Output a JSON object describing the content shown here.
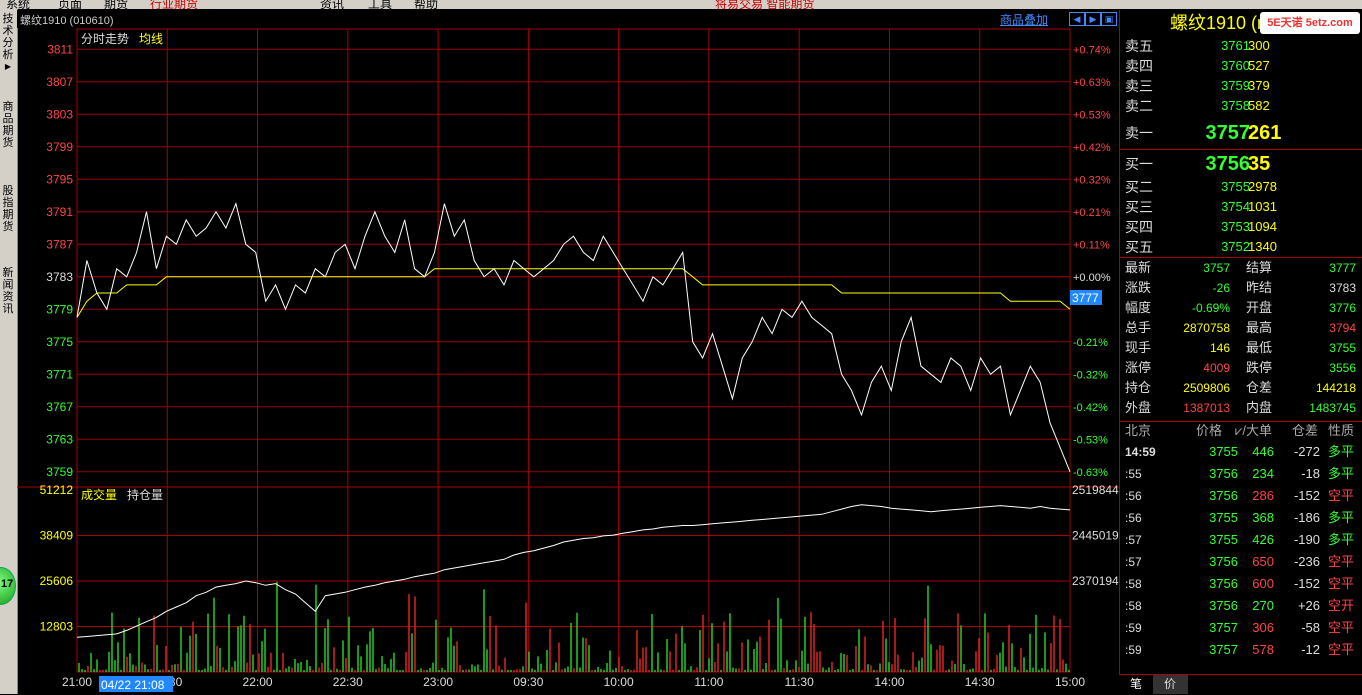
{
  "menu": [
    "系统",
    "页面",
    "期货",
    "行业期货",
    "",
    "资讯",
    "工具",
    "帮助"
  ],
  "menu_center": "将易交易 智能期货",
  "left_tabs": [
    "技术分析",
    "商品期货",
    "股指期货",
    "新闻资讯"
  ],
  "green_badge": "17",
  "chart_title": "螺纹1910 (010610)",
  "overlay_btn": "商品叠加",
  "price_legend": {
    "main": "分时走势",
    "avg": "均线"
  },
  "vol_legend": {
    "vol": "成交量",
    "oi": "持仓量"
  },
  "cursor_price": "3777",
  "cursor_time": "04/22 21:08",
  "chart_data": {
    "type": "line",
    "title": "螺纹1910 (010610)",
    "y_ticks": [
      "3811",
      "3807",
      "3803",
      "3799",
      "3795",
      "3791",
      "3787",
      "3783",
      "3779",
      "3775",
      "3771",
      "3767",
      "3763",
      "3759"
    ],
    "pct_ticks": [
      "+0.74%",
      "+0.63%",
      "+0.53%",
      "+0.42%",
      "+0.32%",
      "+0.21%",
      "+0.11%",
      "+0.00%",
      "-0.21%",
      "-0.32%",
      "-0.42%",
      "-0.53%",
      "-0.63%"
    ],
    "ylim": [
      3757.5,
      3813
    ],
    "prev_settle": 3783,
    "x_ticks": [
      "21:00",
      "21:30",
      "22:00",
      "22:30",
      "23:00",
      "09:30",
      "10:00",
      "11:00",
      "11:30",
      "14:00",
      "14:30",
      "15:00"
    ],
    "price": [
      3778,
      3785,
      3781,
      3779,
      3784,
      3783,
      3786,
      3791,
      3784,
      3788,
      3787,
      3790,
      3788,
      3789,
      3791,
      3789,
      3792,
      3787,
      3786,
      3780,
      3782,
      3779,
      3782,
      3781,
      3784,
      3783,
      3786,
      3787,
      3784,
      3788,
      3791,
      3788,
      3786,
      3790,
      3784,
      3783,
      3786,
      3792,
      3788,
      3790,
      3785,
      3783,
      3784,
      3782,
      3785,
      3784,
      3783,
      3784,
      3785,
      3787,
      3788,
      3786,
      3785,
      3788,
      3786,
      3784,
      3782,
      3780,
      3783,
      3782,
      3784,
      3786,
      3775,
      3773,
      3776,
      3772,
      3768,
      3773,
      3775,
      3778,
      3776,
      3779,
      3778,
      3780,
      3778,
      3777,
      3776,
      3771,
      3769,
      3766,
      3770,
      3772,
      3769,
      3775,
      3778,
      3772,
      3771,
      3770,
      3773,
      3772,
      3769,
      3773,
      3771,
      3772,
      3766,
      3769,
      3772,
      3770,
      3765,
      3762,
      3759
    ],
    "avg": [
      3778,
      3780,
      3781,
      3781,
      3781,
      3782,
      3782,
      3782,
      3782,
      3783,
      3783,
      3783,
      3783,
      3783,
      3783,
      3783,
      3783,
      3783,
      3783,
      3783,
      3783,
      3783,
      3783,
      3783,
      3783,
      3783,
      3783,
      3783,
      3783,
      3783,
      3783,
      3783,
      3783,
      3783,
      3783,
      3783,
      3784,
      3784,
      3784,
      3784,
      3784,
      3784,
      3784,
      3784,
      3784,
      3784,
      3784,
      3784,
      3784,
      3784,
      3784,
      3784,
      3784,
      3784,
      3784,
      3784,
      3784,
      3784,
      3784,
      3784,
      3784,
      3784,
      3783,
      3782,
      3782,
      3782,
      3782,
      3782,
      3782,
      3782,
      3782,
      3782,
      3782,
      3782,
      3782,
      3782,
      3782,
      3781,
      3781,
      3781,
      3781,
      3781,
      3781,
      3781,
      3781,
      3781,
      3781,
      3781,
      3781,
      3781,
      3781,
      3781,
      3781,
      3781,
      3780,
      3780,
      3780,
      3780,
      3780,
      3780,
      3779
    ],
    "vol_ticks": [
      "51212",
      "38409",
      "25606",
      "12803"
    ],
    "oi_ticks": [
      "2519844",
      "2445019",
      "2370194"
    ],
    "vol_max": 51212,
    "oi_range": [
      2330000,
      2540000
    ],
    "oi": [
      2370000,
      2371000,
      2372000,
      2373000,
      2374000,
      2378000,
      2383000,
      2388000,
      2393000,
      2400000,
      2405000,
      2410000,
      2418000,
      2422000,
      2428000,
      2430000,
      2432000,
      2435000,
      2433000,
      2430000,
      2432000,
      2425000,
      2420000,
      2410000,
      2400000,
      2418000,
      2420000,
      2422000,
      2425000,
      2428000,
      2430000,
      2433000,
      2435000,
      2437000,
      2440000,
      2442000,
      2444000,
      2448000,
      2450000,
      2452000,
      2454000,
      2456000,
      2458000,
      2460000,
      2465000,
      2468000,
      2470000,
      2473000,
      2476000,
      2480000,
      2482000,
      2484000,
      2485000,
      2487000,
      2488000,
      2490000,
      2492000,
      2494000,
      2495000,
      2497000,
      2498000,
      2499000,
      2499000,
      2500000,
      2501000,
      2502000,
      2503000,
      2504000,
      2505000,
      2506000,
      2507000,
      2508000,
      2509000,
      2510000,
      2511000,
      2512000,
      2515000,
      2518000,
      2521000,
      2523000,
      2522000,
      2521000,
      2519000,
      2518000,
      2517000,
      2516000,
      2515000,
      2516000,
      2517000,
      2518000,
      2519000,
      2520000,
      2521000,
      2522000,
      2521000,
      2520000,
      2519000,
      2521000,
      2519000,
      2518000,
      2517000
    ]
  },
  "order_book": {
    "asks": [
      {
        "label": "卖五",
        "price": "3761",
        "vol": "300"
      },
      {
        "label": "卖四",
        "price": "3760",
        "vol": "527"
      },
      {
        "label": "卖三",
        "price": "3759",
        "vol": "379"
      },
      {
        "label": "卖二",
        "price": "3758",
        "vol": "582"
      }
    ],
    "ask1": {
      "label": "卖一",
      "price": "3757",
      "vol": "261"
    },
    "bid1": {
      "label": "买一",
      "price": "3756",
      "vol": "35"
    },
    "bids": [
      {
        "label": "买二",
        "price": "3755",
        "vol": "2978"
      },
      {
        "label": "买三",
        "price": "3754",
        "vol": "1031"
      },
      {
        "label": "买四",
        "price": "3753",
        "vol": "1094"
      },
      {
        "label": "买五",
        "price": "3752",
        "vol": "1340"
      }
    ]
  },
  "right_title": "螺纹1910 (r",
  "brand": "5E天诺 5etz.com",
  "stats": [
    {
      "l1": "最新",
      "v1": "3757",
      "c1": "#3f3",
      "l2": "结算",
      "v2": "3777",
      "c2": "#3f3"
    },
    {
      "l1": "涨跌",
      "v1": "-26",
      "c1": "#3f3",
      "l2": "昨结",
      "v2": "3783",
      "c2": "#ddd"
    },
    {
      "l1": "幅度",
      "v1": "-0.69%",
      "c1": "#3f3",
      "l2": "开盘",
      "v2": "3776",
      "c2": "#3f3"
    },
    {
      "l1": "总手",
      "v1": "2870758",
      "c1": "#ff0",
      "l2": "最高",
      "v2": "3794",
      "c2": "#f44"
    },
    {
      "l1": "现手",
      "v1": "146",
      "c1": "#ff0",
      "l2": "最低",
      "v2": "3755",
      "c2": "#3f3"
    },
    {
      "l1": "涨停",
      "v1": "4009",
      "c1": "#f44",
      "l2": "跌停",
      "v2": "3556",
      "c2": "#3f3"
    },
    {
      "l1": "持仓",
      "v1": "2509806",
      "c1": "#ff0",
      "l2": "仓差",
      "v2": "144218",
      "c2": "#ff0"
    },
    {
      "l1": "外盘",
      "v1": "1387013",
      "c1": "#f44",
      "l2": "内盘",
      "v2": "1483745",
      "c2": "#3f3"
    }
  ],
  "ticks_header": {
    "loc": "北京",
    "price": "价格",
    "vol": "⩗/大单",
    "oi": "仓差",
    "nature": "性质"
  },
  "ticks": [
    {
      "t": "14:59",
      "p": "3755",
      "v": "446",
      "oi": "-272",
      "n": "多平",
      "pc": "#3f3",
      "vc": "#3f3",
      "nc": "#3f3"
    },
    {
      "t": ":55",
      "p": "3756",
      "v": "234",
      "oi": "-18",
      "n": "多平",
      "pc": "#3f3",
      "vc": "#3f3",
      "nc": "#3f3"
    },
    {
      "t": ":56",
      "p": "3756",
      "v": "286",
      "oi": "-152",
      "n": "空平",
      "pc": "#3f3",
      "vc": "#f44",
      "nc": "#f44"
    },
    {
      "t": ":56",
      "p": "3755",
      "v": "368",
      "oi": "-186",
      "n": "多平",
      "pc": "#3f3",
      "vc": "#3f3",
      "nc": "#3f3"
    },
    {
      "t": ":57",
      "p": "3755",
      "v": "426",
      "oi": "-190",
      "n": "多平",
      "pc": "#3f3",
      "vc": "#3f3",
      "nc": "#3f3"
    },
    {
      "t": ":57",
      "p": "3756",
      "v": "650",
      "oi": "-236",
      "n": "空平",
      "pc": "#3f3",
      "vc": "#f44",
      "nc": "#f44"
    },
    {
      "t": ":58",
      "p": "3756",
      "v": "600",
      "oi": "-152",
      "n": "空平",
      "pc": "#3f3",
      "vc": "#f44",
      "nc": "#f44"
    },
    {
      "t": ":58",
      "p": "3756",
      "v": "270",
      "oi": "+26",
      "n": "空开",
      "pc": "#3f3",
      "vc": "#3f3",
      "nc": "#f44"
    },
    {
      "t": ":59",
      "p": "3757",
      "v": "306",
      "oi": "-58",
      "n": "空平",
      "pc": "#3f3",
      "vc": "#f44",
      "nc": "#f44"
    },
    {
      "t": ":59",
      "p": "3757",
      "v": "578",
      "oi": "-12",
      "n": "空平",
      "pc": "#3f3",
      "vc": "#f44",
      "nc": "#f44"
    }
  ],
  "bottom_tabs": [
    "笔",
    "价"
  ]
}
